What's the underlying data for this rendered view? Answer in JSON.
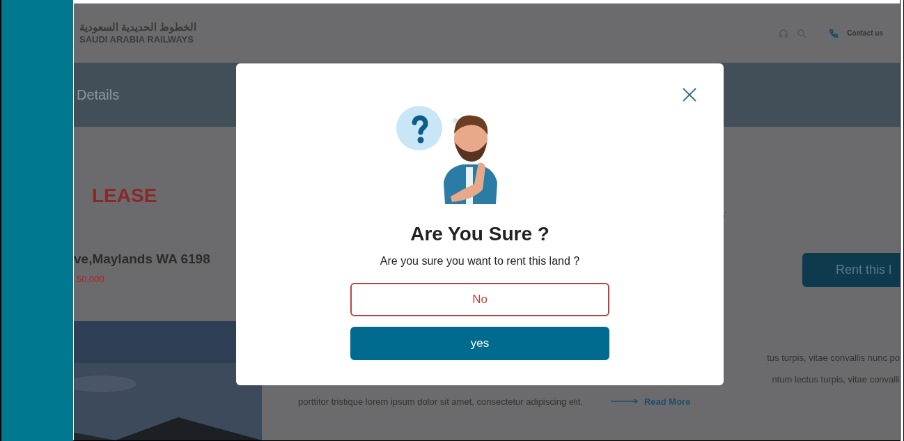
{
  "page": {
    "logo": {
      "arabic": "الخطوط الحديدية السعودية",
      "english": "SAUDI ARABIA RAILWAYS"
    },
    "header_link": "Contact us",
    "banner_title": "Details",
    "listing": {
      "type": "LEASE",
      "address": "ve,Maylands WA 6198",
      "price": "50,000",
      "action": "Rent this l"
    },
    "description": [
      "tus turpis, vitae convallis nunc po",
      "ntum lectus turpis, vitae convalli",
      "porttitor tristique lorem ipsum dolor sit amet, consectetur adipiscing elit."
    ],
    "read_more": "Read More"
  },
  "dialog": {
    "title": "Are You Sure ?",
    "message": "Are you sure you want to rent this land ?",
    "buttons": [
      {
        "label": "No",
        "kind": "outline"
      },
      {
        "label": "yes",
        "kind": "primary"
      }
    ]
  }
}
